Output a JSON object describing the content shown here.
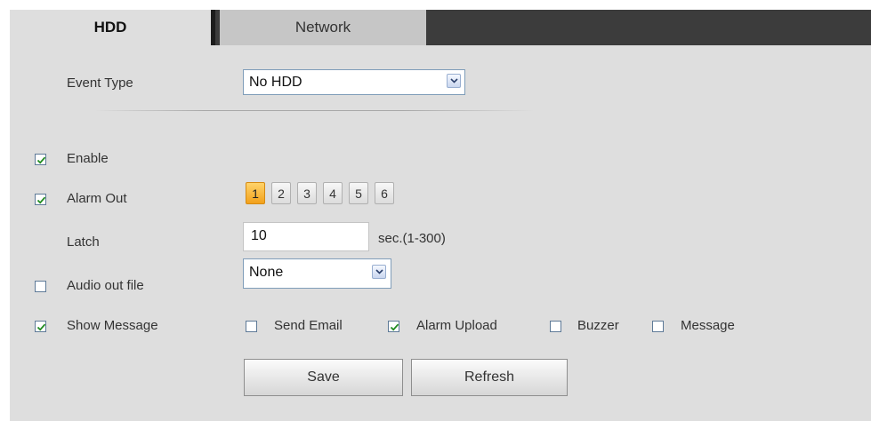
{
  "tabs": [
    {
      "label": "HDD",
      "active": true
    },
    {
      "label": "Network",
      "active": false
    }
  ],
  "event_type": {
    "label": "Event Type",
    "value": "No HDD"
  },
  "enable": {
    "label": "Enable",
    "checked": true
  },
  "alarm_out": {
    "label": "Alarm Out",
    "checked": true,
    "channels": [
      "1",
      "2",
      "3",
      "4",
      "5",
      "6"
    ],
    "selected_channel": "1"
  },
  "latch": {
    "label": "Latch",
    "value": "10",
    "unit": "sec.(1-300)"
  },
  "audio_out_file": {
    "label": "Audio out file",
    "checked": false,
    "value": "None"
  },
  "show_message": {
    "label": "Show Message",
    "checked": true
  },
  "options": [
    {
      "label": "Send Email",
      "checked": false
    },
    {
      "label": "Alarm Upload",
      "checked": true
    },
    {
      "label": "Buzzer",
      "checked": false
    },
    {
      "label": "Message",
      "checked": false
    }
  ],
  "buttons": {
    "save": "Save",
    "refresh": "Refresh"
  },
  "colors": {
    "active_channel": "#f2a11b",
    "tab_bar": "#3c3c3c",
    "panel": "#dedede",
    "checkmark": "#1e8a1e"
  }
}
